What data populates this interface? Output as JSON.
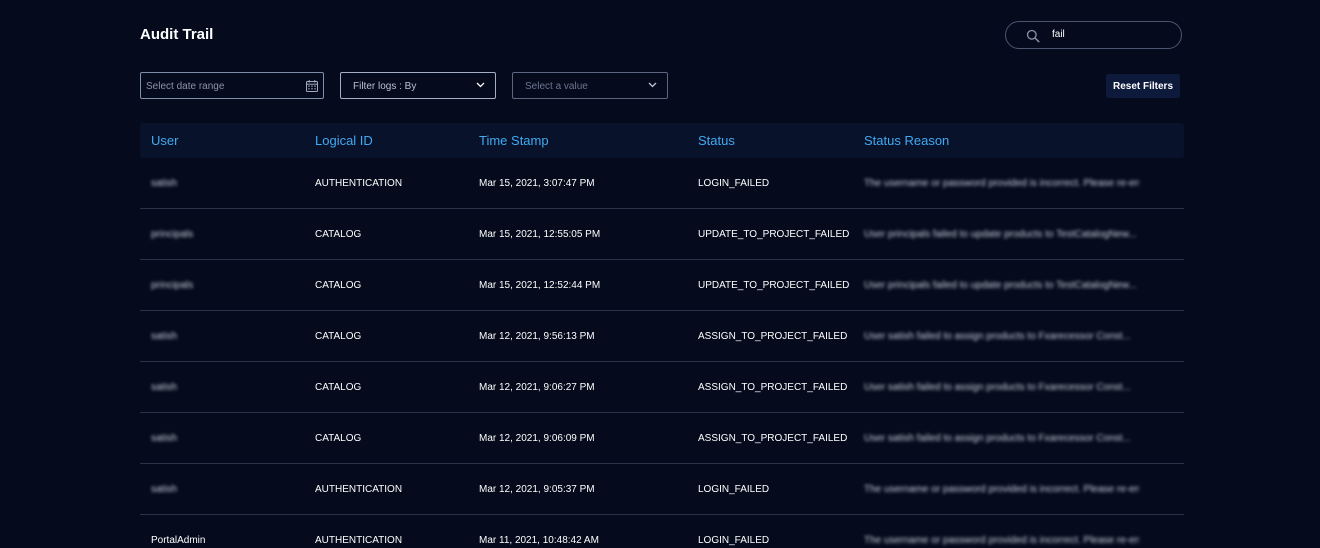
{
  "page": {
    "title": "Audit Trail"
  },
  "search": {
    "icon": "search-icon",
    "value": "fail"
  },
  "filters": {
    "date_range_placeholder": "Select date range",
    "date_icon": "calendar-icon",
    "filter_logs_label": "Filter logs : By",
    "value_placeholder": "Select a value",
    "reset_label": "Reset Filters"
  },
  "table": {
    "headers": {
      "user": "User",
      "logical_id": "Logical ID",
      "timestamp": "Time Stamp",
      "status": "Status",
      "status_reason": "Status Reason"
    },
    "rows": [
      {
        "user": "satish",
        "logical_id": "AUTHENTICATION",
        "timestamp": "Mar 15, 2021, 3:07:47 PM",
        "status": "LOGIN_FAILED",
        "status_reason": "The username or password provided is incorrect. Please re-en..."
      },
      {
        "user": "principals",
        "logical_id": "CATALOG",
        "timestamp": "Mar 15, 2021, 12:55:05 PM",
        "status": "UPDATE_TO_PROJECT_FAILED",
        "status_reason": "User principals failed to update products to TestCatalogNew..."
      },
      {
        "user": "principals",
        "logical_id": "CATALOG",
        "timestamp": "Mar 15, 2021, 12:52:44 PM",
        "status": "UPDATE_TO_PROJECT_FAILED",
        "status_reason": "User principals failed to update products to TestCatalogNew..."
      },
      {
        "user": "satish",
        "logical_id": "CATALOG",
        "timestamp": "Mar 12, 2021, 9:56:13 PM",
        "status": "ASSIGN_TO_PROJECT_FAILED",
        "status_reason": "User satish failed to assign products to Fxarecessor Const..."
      },
      {
        "user": "satish",
        "logical_id": "CATALOG",
        "timestamp": "Mar 12, 2021, 9:06:27 PM",
        "status": "ASSIGN_TO_PROJECT_FAILED",
        "status_reason": "User satish failed to assign products to Fxarecessor Const..."
      },
      {
        "user": "satish",
        "logical_id": "CATALOG",
        "timestamp": "Mar 12, 2021, 9:06:09 PM",
        "status": "ASSIGN_TO_PROJECT_FAILED",
        "status_reason": "User satish failed to assign products to Fxarecessor Const..."
      },
      {
        "user": "satish",
        "logical_id": "AUTHENTICATION",
        "timestamp": "Mar 12, 2021, 9:05:37 PM",
        "status": "LOGIN_FAILED",
        "status_reason": "The username or password provided is incorrect. Please re-en..."
      },
      {
        "user": "PortalAdmin",
        "logical_id": "AUTHENTICATION",
        "timestamp": "Mar 11, 2021, 10:48:42 AM",
        "status": "LOGIN_FAILED",
        "status_reason": "The username or password provided is incorrect. Please re-en..."
      }
    ]
  },
  "colors": {
    "background": "#050b1c",
    "header_text": "#40a9f2",
    "header_bg": "#08132b",
    "button_bg": "#0d1a3c"
  }
}
